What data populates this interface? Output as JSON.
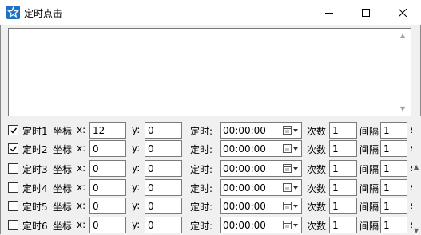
{
  "window": {
    "title": "定时点击",
    "controls": [
      "minimize",
      "maximize",
      "close"
    ]
  },
  "log_area": {
    "value": ""
  },
  "labels": {
    "coord": "坐标",
    "x": "x:",
    "y": "y:",
    "timer": "定时:",
    "count": "次数",
    "interval": "间隔",
    "seconds": "s"
  },
  "rows": [
    {
      "name": "定时1",
      "checked": true,
      "x": "12",
      "y": "0",
      "time": "00:00:00",
      "count": "1",
      "interval": "1"
    },
    {
      "name": "定时2",
      "checked": true,
      "x": "0",
      "y": "0",
      "time": "00:00:00",
      "count": "1",
      "interval": "1"
    },
    {
      "name": "定时3",
      "checked": false,
      "x": "0",
      "y": "0",
      "time": "00:00:00",
      "count": "1",
      "interval": "1"
    },
    {
      "name": "定时4",
      "checked": false,
      "x": "0",
      "y": "0",
      "time": "00:00:00",
      "count": "1",
      "interval": "1"
    },
    {
      "name": "定时5",
      "checked": false,
      "x": "0",
      "y": "0",
      "time": "00:00:00",
      "count": "1",
      "interval": "1"
    },
    {
      "name": "定时6",
      "checked": false,
      "x": "0",
      "y": "0",
      "time": "00:00:00",
      "count": "1",
      "interval": "1"
    }
  ]
}
